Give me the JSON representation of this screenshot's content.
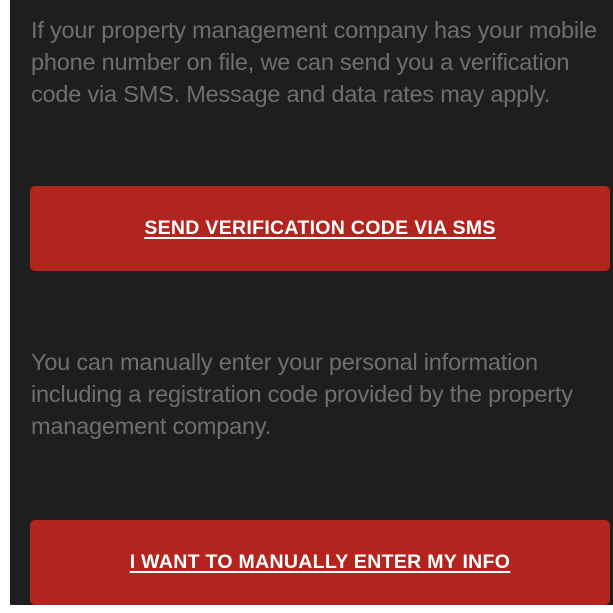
{
  "sms_section": {
    "description": "If your property management company has your mobile phone number on file, we can send you a verification code via SMS. Message and data rates may apply.",
    "button_label": "SEND VERIFICATION CODE VIA SMS"
  },
  "manual_section": {
    "description": "You can manually enter your personal information including a registration code provided by the property management company.",
    "button_label": "I WANT TO MANUALLY ENTER MY INFO"
  },
  "colors": {
    "background": "#1e1e1e",
    "text": "#6f6f6f",
    "button": "#b3241f",
    "button_text": "#ffffff"
  }
}
